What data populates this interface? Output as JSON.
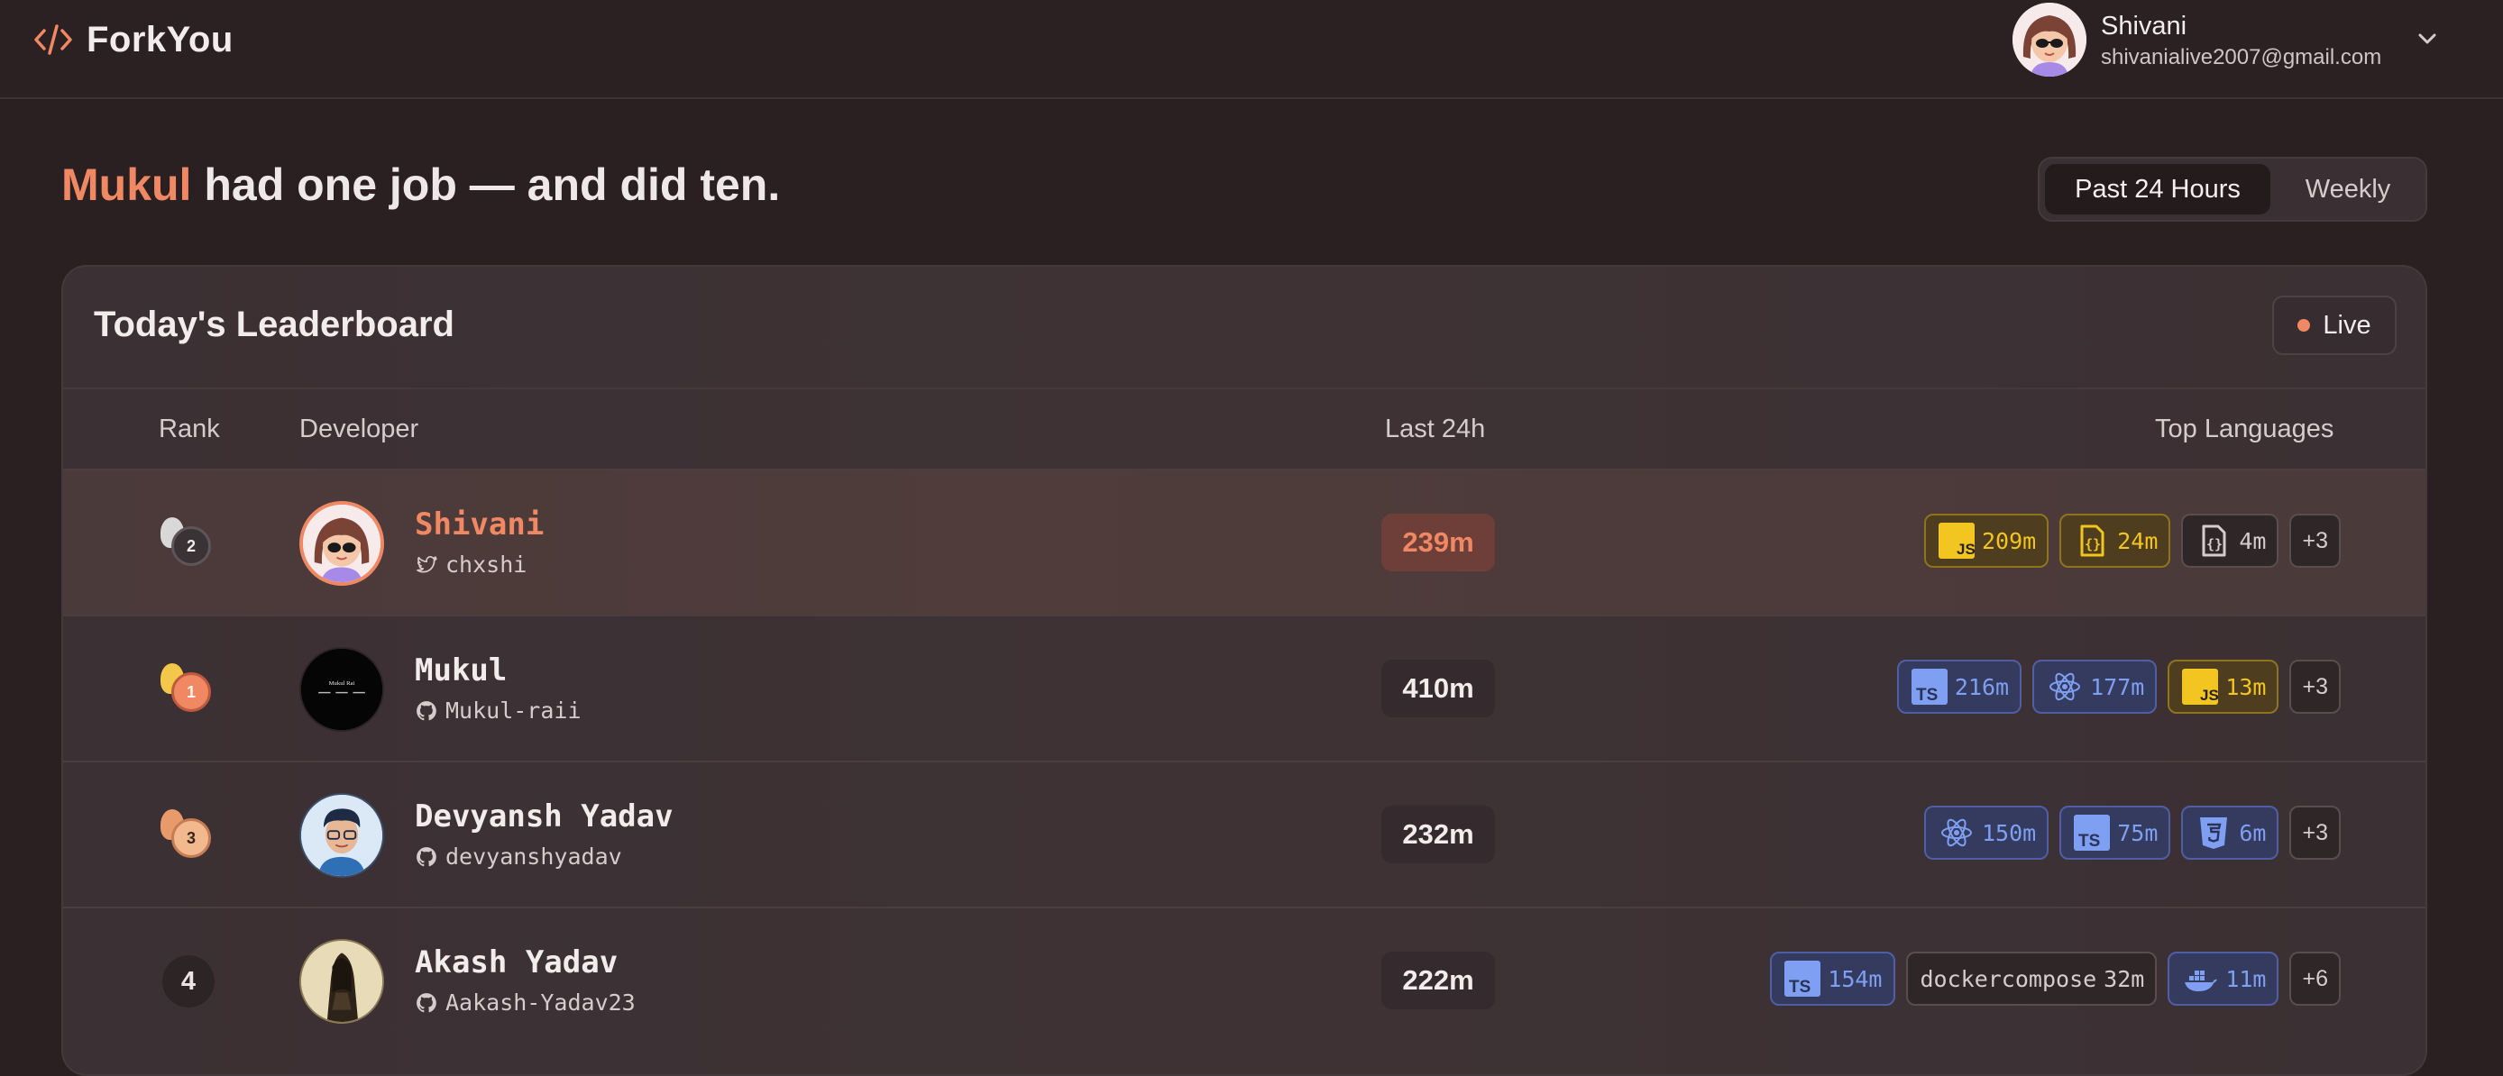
{
  "brand": {
    "name": "ForkYou",
    "colors": {
      "accent": "#ef8863",
      "background": "#2a2022"
    }
  },
  "user": {
    "name": "Shivani",
    "email": "shivanialive2007@gmail.com"
  },
  "hero": {
    "highlight": "Mukul",
    "rest": "had one job — and did ten."
  },
  "period_toggle": {
    "options": [
      "Past 24 Hours",
      "Weekly"
    ],
    "selected": "Past 24 Hours"
  },
  "leaderboard": {
    "title": "Today's Leaderboard",
    "live_label": "Live",
    "columns": {
      "rank": "Rank",
      "developer": "Developer",
      "last": "Last 24h",
      "languages": "Top Languages"
    },
    "rows": [
      {
        "rank": "2",
        "name": "Shivani",
        "handle": "chxshi",
        "handle_icon": "twitter-icon",
        "minutes": "239m",
        "is_current_user": true,
        "languages": [
          {
            "icon": "javascript-icon",
            "value": "209m"
          },
          {
            "icon": "json-icon",
            "value": "24m"
          },
          {
            "icon": "file-code-icon",
            "value": "4m"
          }
        ],
        "more": "+3"
      },
      {
        "rank": "1",
        "name": "Mukul",
        "handle": "Mukul-raii",
        "handle_icon": "github-icon",
        "minutes": "410m",
        "is_current_user": false,
        "languages": [
          {
            "icon": "typescript-icon",
            "value": "216m"
          },
          {
            "icon": "react-icon",
            "value": "177m"
          },
          {
            "icon": "javascript-icon",
            "value": "13m"
          }
        ],
        "more": "+3"
      },
      {
        "rank": "3",
        "name": "Devyansh Yadav",
        "handle": "devyanshyadav",
        "handle_icon": "github-icon",
        "minutes": "232m",
        "is_current_user": false,
        "languages": [
          {
            "icon": "react-icon",
            "value": "150m"
          },
          {
            "icon": "typescript-icon",
            "value": "75m"
          },
          {
            "icon": "css-icon",
            "value": "6m"
          }
        ],
        "more": "+3"
      },
      {
        "rank": "4",
        "name": "Akash Yadav",
        "handle": "Aakash-Yadav23",
        "handle_icon": "github-icon",
        "minutes": "222m",
        "is_current_user": false,
        "languages": [
          {
            "icon": "typescript-icon",
            "value": "154m"
          },
          {
            "label": "dockercompose",
            "value": "32m"
          },
          {
            "icon": "docker-icon",
            "value": "11m"
          }
        ],
        "more": "+6"
      }
    ]
  }
}
